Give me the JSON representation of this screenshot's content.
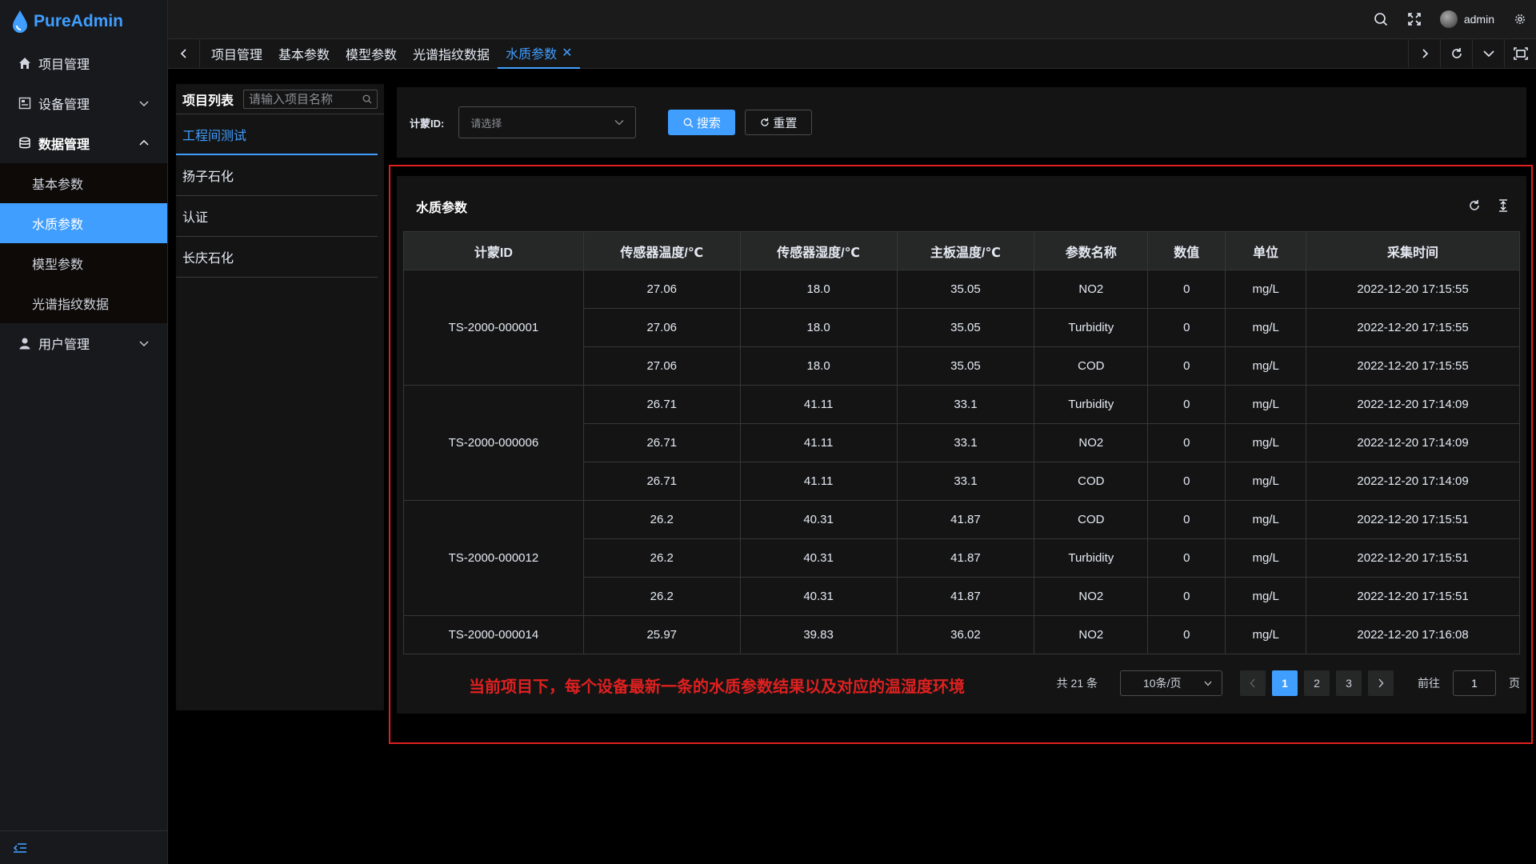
{
  "app": {
    "brand": "PureAdmin",
    "accent": "#409eff",
    "note_color": "#e02020"
  },
  "sidebar": {
    "items": [
      {
        "label": "项目管理",
        "icon": "home-icon"
      },
      {
        "label": "设备管理",
        "icon": "device-icon"
      },
      {
        "label": "数据管理",
        "icon": "database-icon"
      },
      {
        "label": "用户管理",
        "icon": "user-icon"
      }
    ],
    "submenu": [
      "基本参数",
      "水质参数",
      "模型参数",
      "光谱指纹数据"
    ],
    "active_sub": "水质参数"
  },
  "header": {
    "username": "admin"
  },
  "tabs": [
    "项目管理",
    "基本参数",
    "模型参数",
    "光谱指纹数据",
    "水质参数"
  ],
  "project_panel": {
    "title": "项目列表",
    "search_placeholder": "请输入项目名称",
    "items": [
      "工程间测试",
      "扬子石化",
      "认证",
      "长庆石化"
    ]
  },
  "search": {
    "label": "计蒙ID:",
    "placeholder": "请选择",
    "search_button": "搜索",
    "reset_button": "重置"
  },
  "table": {
    "title": "水质参数",
    "columns": [
      "计蒙ID",
      "传感器温度/℃",
      "传感器湿度/℃",
      "主板温度/℃",
      "参数名称",
      "数值",
      "单位",
      "采集时间"
    ],
    "groups": [
      {
        "id": "TS-2000-000001",
        "rows": [
          [
            "27.06",
            "18.0",
            "35.05",
            "NO2",
            "0",
            "mg/L",
            "2022-12-20 17:15:55"
          ],
          [
            "27.06",
            "18.0",
            "35.05",
            "Turbidity",
            "0",
            "mg/L",
            "2022-12-20 17:15:55"
          ],
          [
            "27.06",
            "18.0",
            "35.05",
            "COD",
            "0",
            "mg/L",
            "2022-12-20 17:15:55"
          ]
        ]
      },
      {
        "id": "TS-2000-000006",
        "rows": [
          [
            "26.71",
            "41.11",
            "33.1",
            "Turbidity",
            "0",
            "mg/L",
            "2022-12-20 17:14:09"
          ],
          [
            "26.71",
            "41.11",
            "33.1",
            "NO2",
            "0",
            "mg/L",
            "2022-12-20 17:14:09"
          ],
          [
            "26.71",
            "41.11",
            "33.1",
            "COD",
            "0",
            "mg/L",
            "2022-12-20 17:14:09"
          ]
        ]
      },
      {
        "id": "TS-2000-000012",
        "rows": [
          [
            "26.2",
            "40.31",
            "41.87",
            "COD",
            "0",
            "mg/L",
            "2022-12-20 17:15:51"
          ],
          [
            "26.2",
            "40.31",
            "41.87",
            "Turbidity",
            "0",
            "mg/L",
            "2022-12-20 17:15:51"
          ],
          [
            "26.2",
            "40.31",
            "41.87",
            "NO2",
            "0",
            "mg/L",
            "2022-12-20 17:15:51"
          ]
        ]
      },
      {
        "id": "TS-2000-000014",
        "rows": [
          [
            "25.97",
            "39.83",
            "36.02",
            "NO2",
            "0",
            "mg/L",
            "2022-12-20 17:16:08"
          ]
        ]
      }
    ]
  },
  "annotation": "当前项目下，每个设备最新一条的水质参数结果以及对应的温湿度环境",
  "pagination": {
    "total_text": "共 21 条",
    "page_size": "10条/页",
    "pages": [
      "1",
      "2",
      "3"
    ],
    "current": "1",
    "goto_label": "前往",
    "goto_value": "1",
    "page_suffix": "页"
  }
}
